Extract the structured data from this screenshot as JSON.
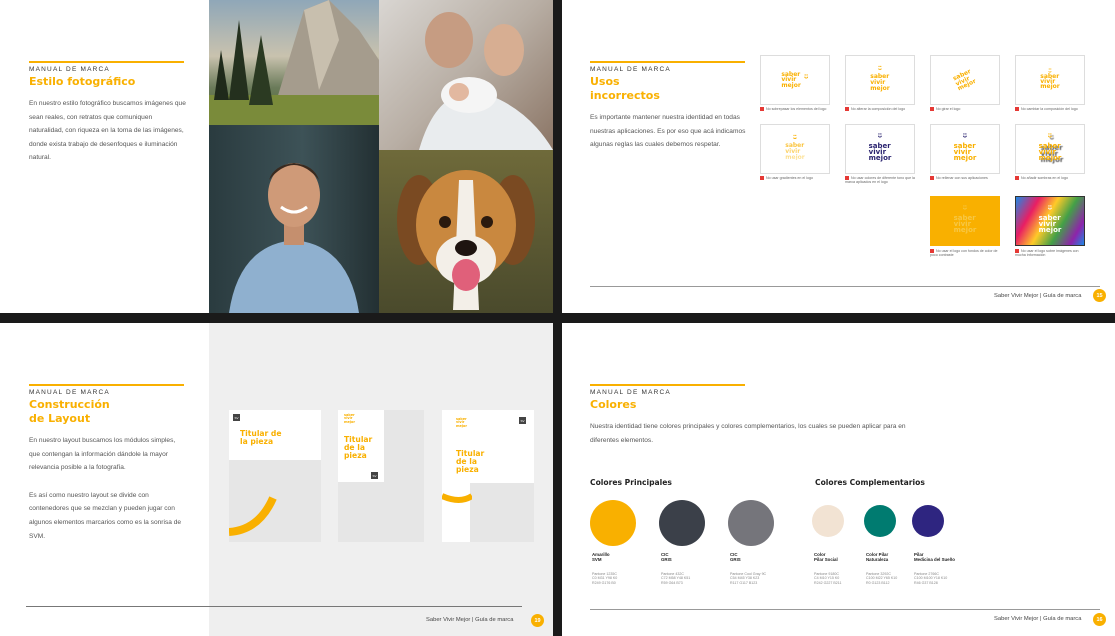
{
  "colors": {
    "accent": "#f9b000",
    "navy": "#2a2370",
    "gray_dark": "#3b4049",
    "gray": "#75757b",
    "cream": "#f2e3d3",
    "teal": "#007b70",
    "purple": "#2e2580",
    "error": "#e53935"
  },
  "page1": {
    "kicker": "MANUAL DE MARCA",
    "title": "Estilo fotográfico",
    "body": "En nuestro estilo fotográfico buscamos imágenes que sean reales, con retratos que comuniquen naturalidad, con riqueza en la toma de las imágenes, donde exista trabajo de desenfoques e iluminación natural."
  },
  "page2": {
    "kicker": "MANUAL DE MARCA",
    "title_l1": "Usos",
    "title_l2": "incorrectos",
    "body": "Es importante mantener nuestra identidad en todas nuestras aplicaciones. Es por eso que acá indicamos algunas reglas las cuales debemos respetar.",
    "logo_l1": "saber",
    "logo_l2": "vivir",
    "logo_l3": "mejor",
    "captions": [
      "No sobrepasar los elementos del logo",
      "No alterar la composición del logo",
      "No girar el logo",
      "No cambiar la composición del logo",
      "No usar gradientes en el logo",
      "No usar colores de diferente tono que la marca aplicados en el logo",
      "No rellenar con sus aplicaciones",
      "No añadir sombras en el logo",
      "No usar el logo con fondos de color de poco contraste",
      "No usar el logo sobre imágenes con mucha información"
    ],
    "footer": "Saber Vivir Mejor | Guía de marca",
    "page_num": "15"
  },
  "page3": {
    "kicker": "MANUAL DE MARCA",
    "title_l1": "Construcción",
    "title_l2": "de Layout",
    "body1": "En nuestro layout buscamos los módulos simples, que contengan la información dándole la mayor relevancia posible a la fotografía.",
    "body2": "Es así como nuestro layout se divide con contenedores que se mezclan y pueden jugar con algunos elementos marcarios como es la sonrisa de SVM.",
    "card_title_l1": "Titular de",
    "card_title_l2": "la pieza",
    "card2_l1": "Titular",
    "card2_l2": "de la",
    "card2_l3": "pieza",
    "badge": "SV",
    "footer": "Saber Vivir Mejor | Guía de marca",
    "page_num": "19"
  },
  "page4": {
    "kicker": "MANUAL DE MARCA",
    "title": "Colores",
    "body": "Nuestra identidad tiene colores principales y colores complementarios, los cuales se pueden aplicar para en diferentes elementos.",
    "principal_heading": "Colores Principales",
    "complement_heading": "Colores Complementarios",
    "swatches": [
      {
        "name1": "Amarillo",
        "name2": "SVM",
        "d1": "Pantone 1235C",
        "d2": "C0 M31 Y98 K0",
        "d3": "R249 G176 B0",
        "color": "#f9b000"
      },
      {
        "name1": "CIC",
        "name2": "GRIS",
        "d1": "Pantone 432C",
        "d2": "C72 M58 Y48 K51",
        "d3": "R59 G64 B73",
        "color": "#3b4049"
      },
      {
        "name1": "CIC",
        "name2": "GRIS",
        "d1": "Pantone Cool Gray 9C",
        "d2": "C54 M45 Y38 K23",
        "d3": "R117 G117 B123",
        "color": "#75757b"
      },
      {
        "name1": "Color",
        "name2": "Pilar Social",
        "d1": "Pantone 9180C",
        "d2": "C4 M10 Y15 K0",
        "d3": "R242 G227 B211",
        "color": "#f2e3d3"
      },
      {
        "name1": "Color Pilar",
        "name2": "Naturaleza",
        "d1": "Pantone 3292C",
        "d2": "C100 M22 Y65 K10",
        "d3": "R0 G123 B112",
        "color": "#007b70"
      },
      {
        "name1": "Pilar",
        "name2": "Medicina del Sueño",
        "d1": "Pantone 2766C",
        "d2": "C100 M100 Y18 K10",
        "d3": "R46 G37 B128",
        "color": "#2e2580"
      }
    ],
    "footer": "Saber Vivir Mejor | Guía de marca",
    "page_num": "16"
  }
}
